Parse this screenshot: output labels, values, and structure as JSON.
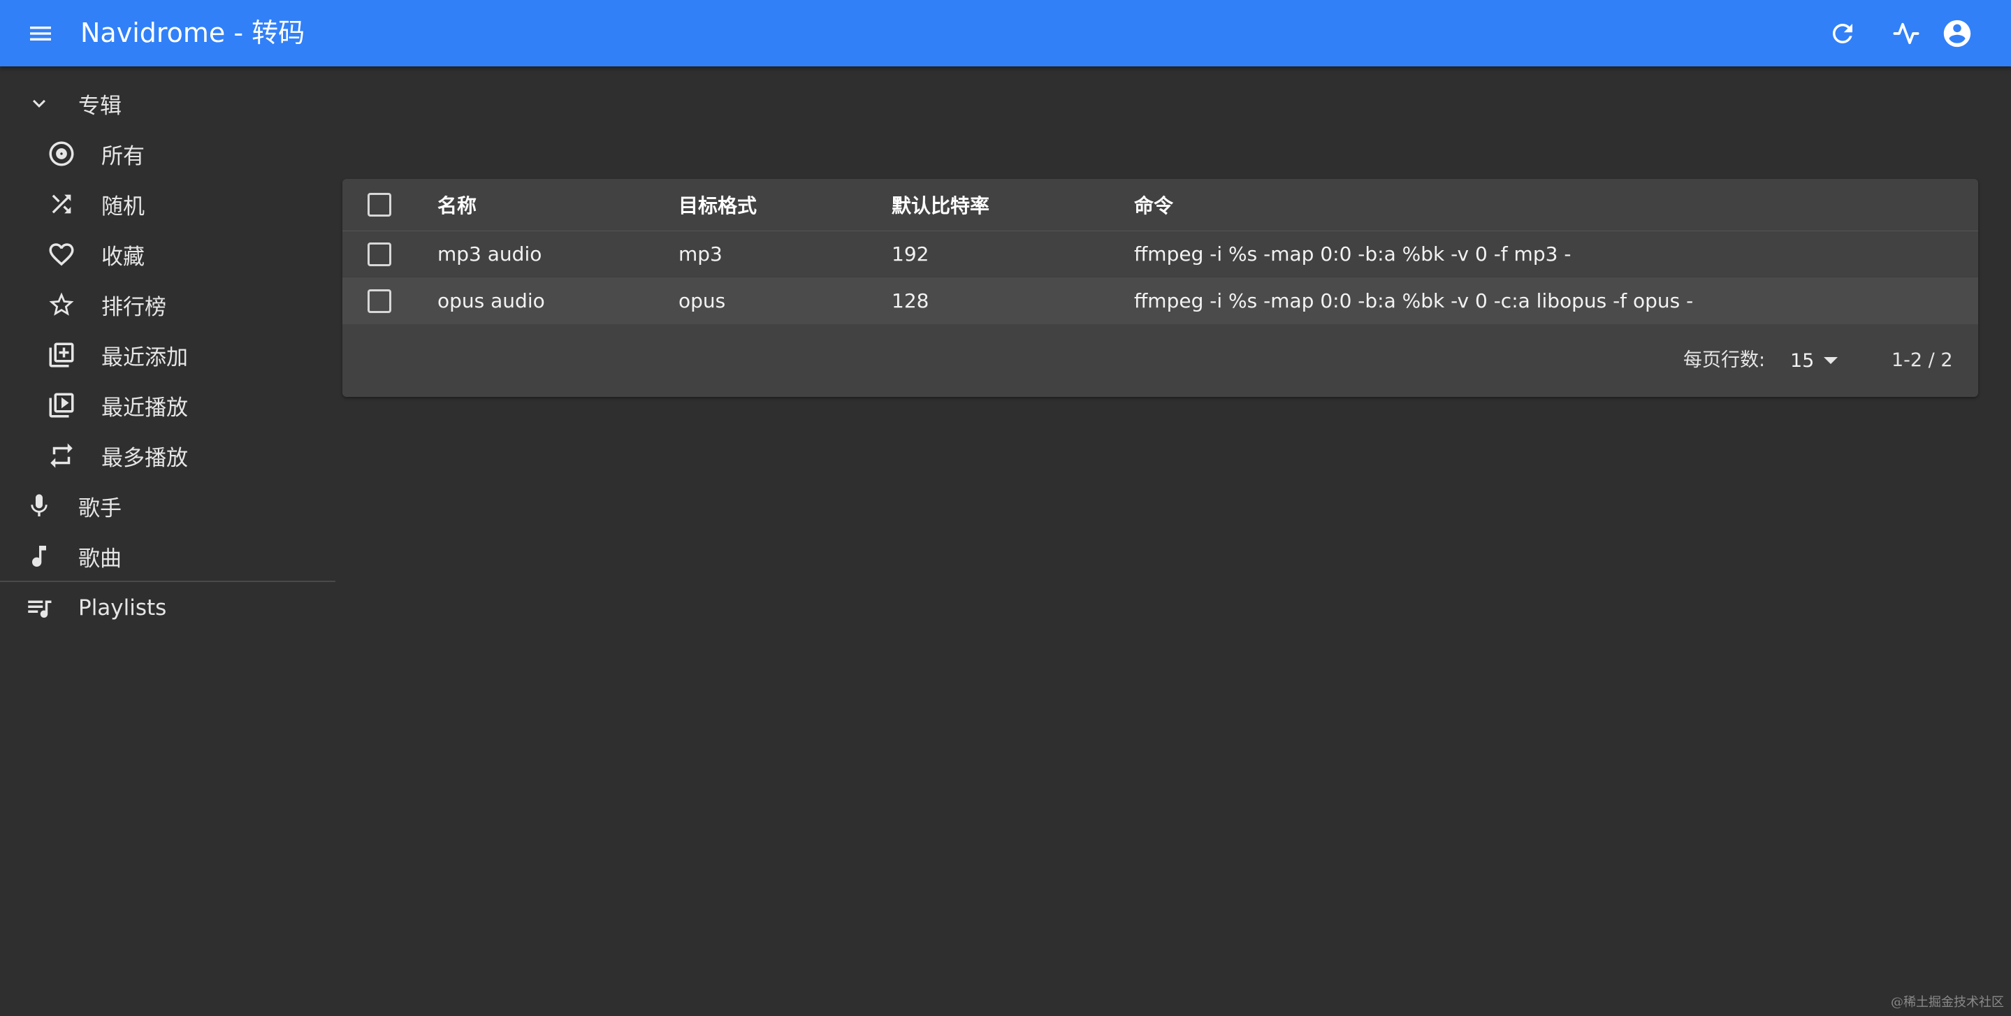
{
  "appbar": {
    "title": "Navidrome - 转码",
    "icons": {
      "menu": "menu-icon",
      "refresh": "refresh-icon",
      "activity": "activity-icon",
      "account": "account-circle-icon"
    },
    "color": "#3180f8"
  },
  "sidebar": {
    "albums": {
      "label": "专辑",
      "icon": "chevron-down-icon",
      "expanded": true,
      "items": [
        {
          "label": "所有",
          "icon": "album-icon"
        },
        {
          "label": "随机",
          "icon": "shuffle-icon"
        },
        {
          "label": "收藏",
          "icon": "heart-icon"
        },
        {
          "label": "排行榜",
          "icon": "star-icon"
        },
        {
          "label": "最近添加",
          "icon": "library-add-icon"
        },
        {
          "label": "最近播放",
          "icon": "video-library-icon"
        },
        {
          "label": "最多播放",
          "icon": "repeat-icon"
        }
      ]
    },
    "artists": {
      "label": "歌手",
      "icon": "mic-icon"
    },
    "songs": {
      "label": "歌曲",
      "icon": "music-note-icon"
    },
    "playlists": {
      "label": "Playlists",
      "icon": "queue-music-icon"
    }
  },
  "table": {
    "columns": [
      "名称",
      "目标格式",
      "默认比特率",
      "命令"
    ],
    "rows": [
      {
        "name": "mp3 audio",
        "format": "mp3",
        "bitrate": "192",
        "command": "ffmpeg -i %s -map 0:0 -b:a %bk -v 0 -f mp3 -"
      },
      {
        "name": "opus audio",
        "format": "opus",
        "bitrate": "128",
        "command": "ffmpeg -i %s -map 0:0 -b:a %bk -v 0 -c:a libopus -f opus -"
      }
    ],
    "pagination": {
      "rows_per_page_label": "每页行数:",
      "rows_per_page": "15",
      "range": "1-2 / 2"
    }
  },
  "watermark": "@稀土掘金技术社区"
}
